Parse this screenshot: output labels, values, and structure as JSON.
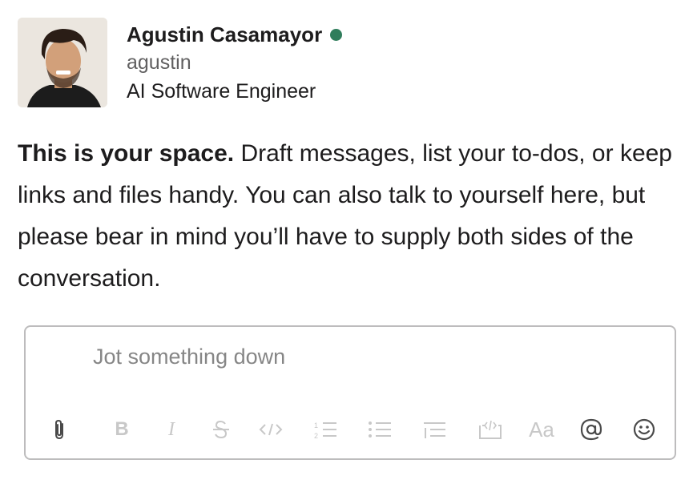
{
  "profile": {
    "name": "Agustin Casamayor",
    "status": "online",
    "handle": "agustin",
    "title": "AI Software Engineer"
  },
  "intro": {
    "lead": "This is your space.",
    "body": " Draft messages, list your to-dos, or keep links and files handy. You can also talk to yourself here, but please bear in mind you’ll have to supply both sides of the conversation."
  },
  "composer": {
    "placeholder": "Jot something down",
    "toolbar": {
      "text_style_label": "Aa"
    }
  },
  "colors": {
    "presence": "#2f7d5b",
    "disabled_icon": "#c8c8c8",
    "active_icon": "#4a4a4a"
  }
}
